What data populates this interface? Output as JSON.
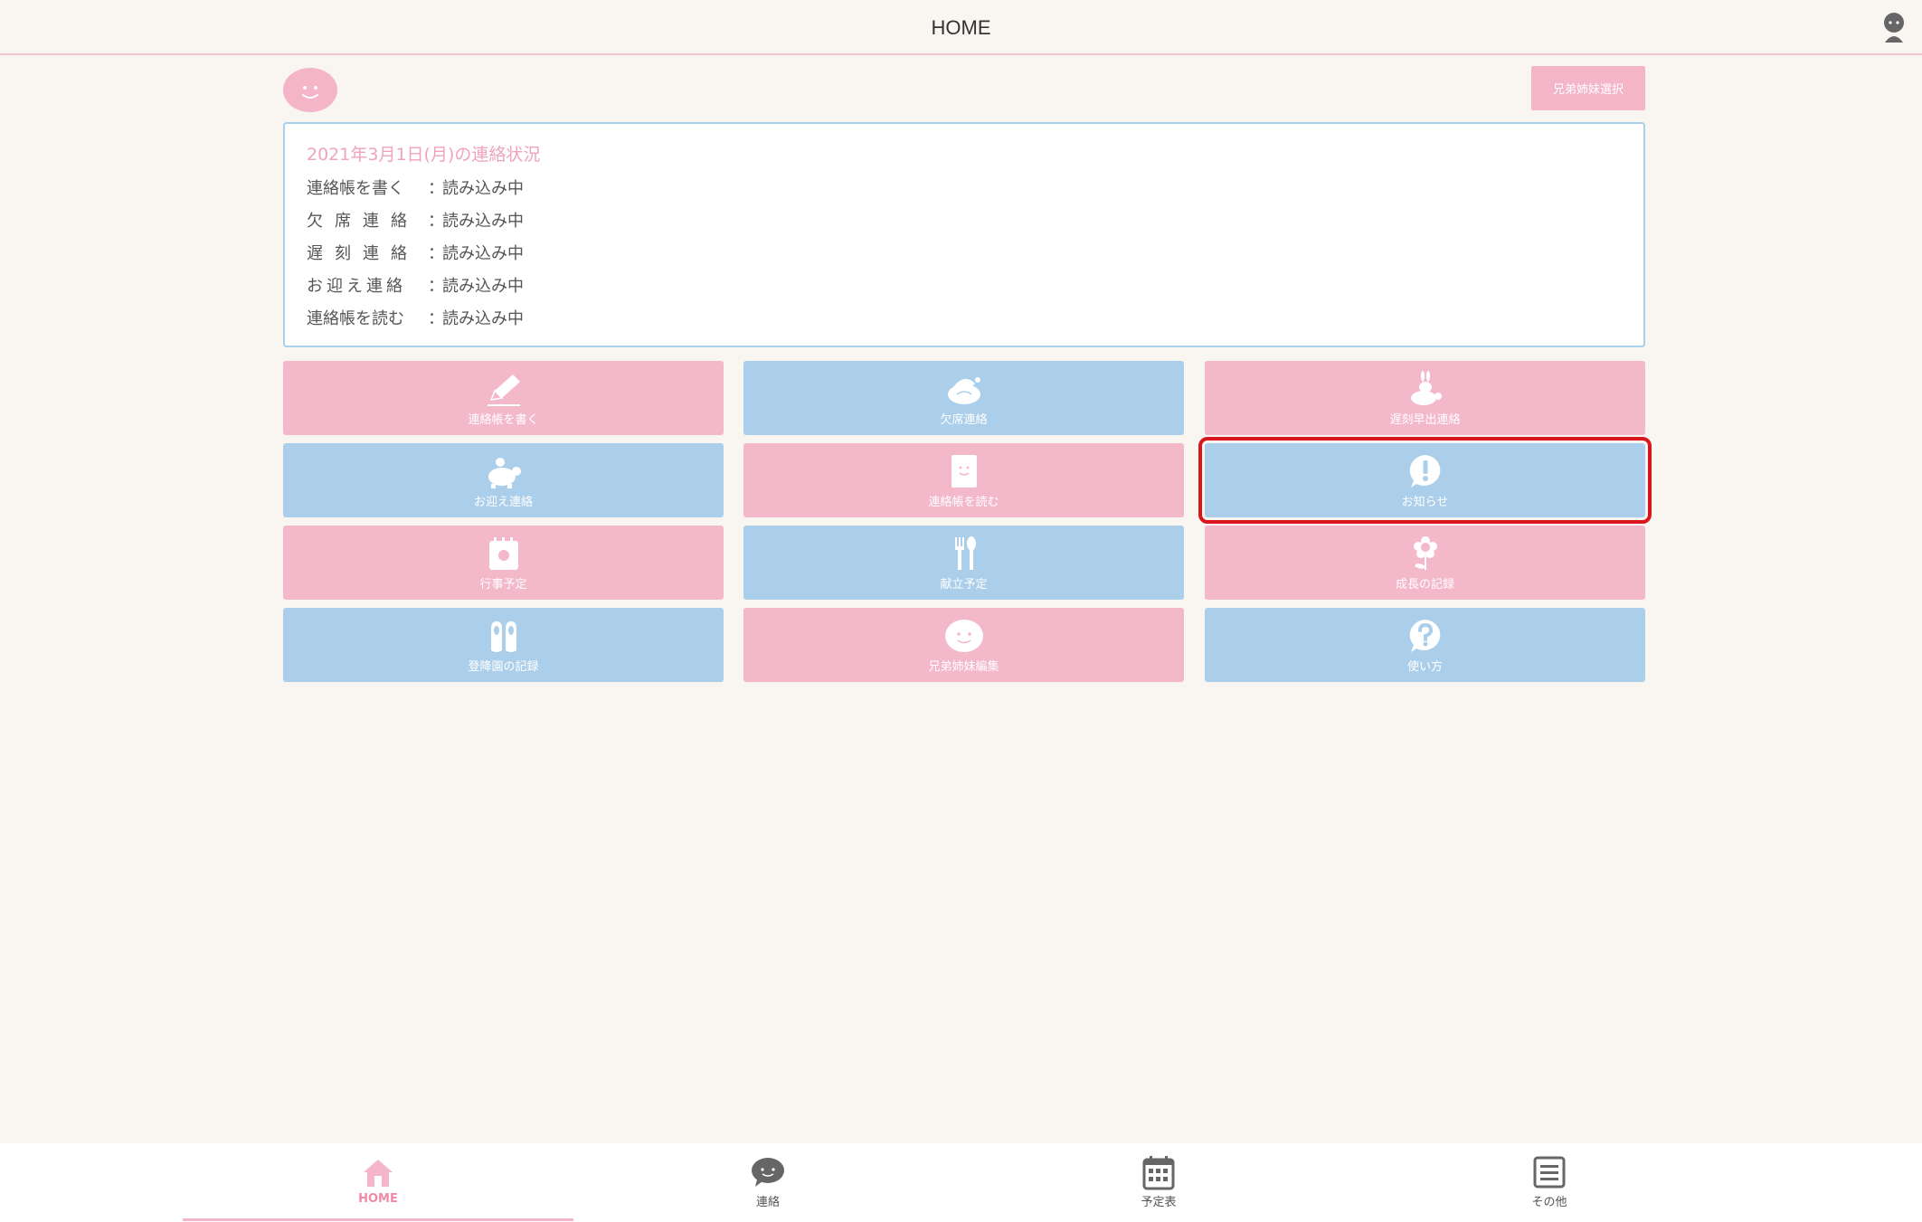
{
  "header": {
    "title": "HOME"
  },
  "sibling_select_label": "兄弟姉妹選択",
  "status": {
    "title": "2021年3月1日(月)の連絡状況",
    "rows": [
      {
        "label": "連絡帳を書く",
        "value": "読み込み中"
      },
      {
        "label": "欠席連絡",
        "value": "読み込み中"
      },
      {
        "label": "遅刻連絡",
        "value": "読み込み中"
      },
      {
        "label": "お迎え連絡",
        "value": "読み込み中"
      },
      {
        "label": "連絡帳を読む",
        "value": "読み込み中"
      }
    ],
    "separator": "："
  },
  "menu": [
    {
      "label": "連絡帳を書く",
      "icon": "pencil-icon",
      "color": "pink"
    },
    {
      "label": "欠席連絡",
      "icon": "sleeping-turtle-icon",
      "color": "blue"
    },
    {
      "label": "遅刻早出連絡",
      "icon": "rabbit-turtle-icon",
      "color": "pink"
    },
    {
      "label": "お迎え連絡",
      "icon": "turtle-icon",
      "color": "blue"
    },
    {
      "label": "連絡帳を読む",
      "icon": "notebook-icon",
      "color": "pink"
    },
    {
      "label": "お知らせ",
      "icon": "exclamation-icon",
      "color": "blue",
      "selected": true
    },
    {
      "label": "行事予定",
      "icon": "calendar-icon",
      "color": "pink"
    },
    {
      "label": "献立予定",
      "icon": "fork-spoon-icon",
      "color": "blue"
    },
    {
      "label": "成長の記録",
      "icon": "flower-icon",
      "color": "pink"
    },
    {
      "label": "登降園の記録",
      "icon": "shoes-icon",
      "color": "blue"
    },
    {
      "label": "兄弟姉妹編集",
      "icon": "smile-face-icon",
      "color": "pink"
    },
    {
      "label": "使い方",
      "icon": "question-icon",
      "color": "blue"
    }
  ],
  "bottom_nav": [
    {
      "label": "HOME",
      "icon": "home-icon",
      "active": true
    },
    {
      "label": "連絡",
      "icon": "chat-bubble-icon"
    },
    {
      "label": "予定表",
      "icon": "calendar-icon"
    },
    {
      "label": "その他",
      "icon": "menu-list-icon"
    }
  ],
  "colors": {
    "pink": "#f4b8cb",
    "blue": "#abcfea",
    "highlight": "#d9151d"
  }
}
